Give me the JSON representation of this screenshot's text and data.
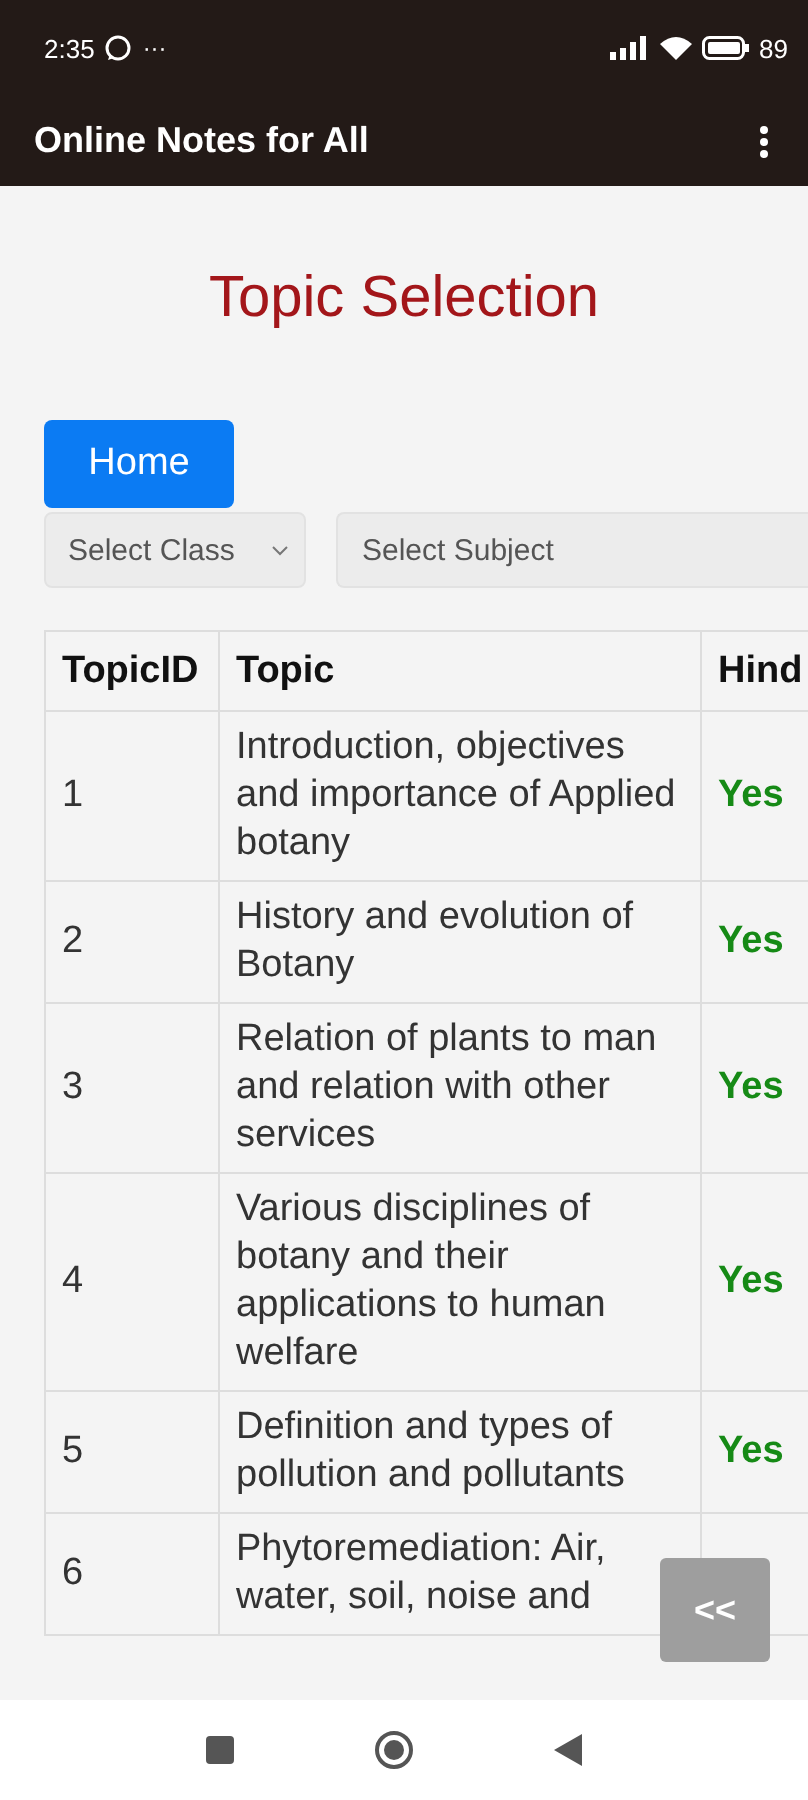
{
  "status_bar": {
    "time": "2:35",
    "more": "···",
    "battery": "89"
  },
  "app_bar": {
    "title": "Online Notes for All"
  },
  "page_title": "Topic Selection",
  "home_button": "Home",
  "class_select": {
    "placeholder": "Select Class"
  },
  "subject_select": {
    "placeholder": "Select Subject"
  },
  "table": {
    "columns": [
      "TopicID",
      "Topic",
      "Hind"
    ],
    "rows": [
      {
        "id": "1",
        "topic": "Introduction, objectives and importance of Applied botany",
        "hindi": "Yes"
      },
      {
        "id": "2",
        "topic": "History and evolution of Botany",
        "hindi": "Yes"
      },
      {
        "id": "3",
        "topic": "Relation of plants to man and relation with other services",
        "hindi": "Yes"
      },
      {
        "id": "4",
        "topic": "Various disciplines of botany and their applications to human welfare",
        "hindi": "Yes"
      },
      {
        "id": "5",
        "topic": "Definition and types of pollution and pollutants",
        "hindi": "Yes"
      },
      {
        "id": "6",
        "topic": "Phytoremediation: Air, water, soil, noise and"
      }
    ]
  },
  "scroll_button": "<<"
}
